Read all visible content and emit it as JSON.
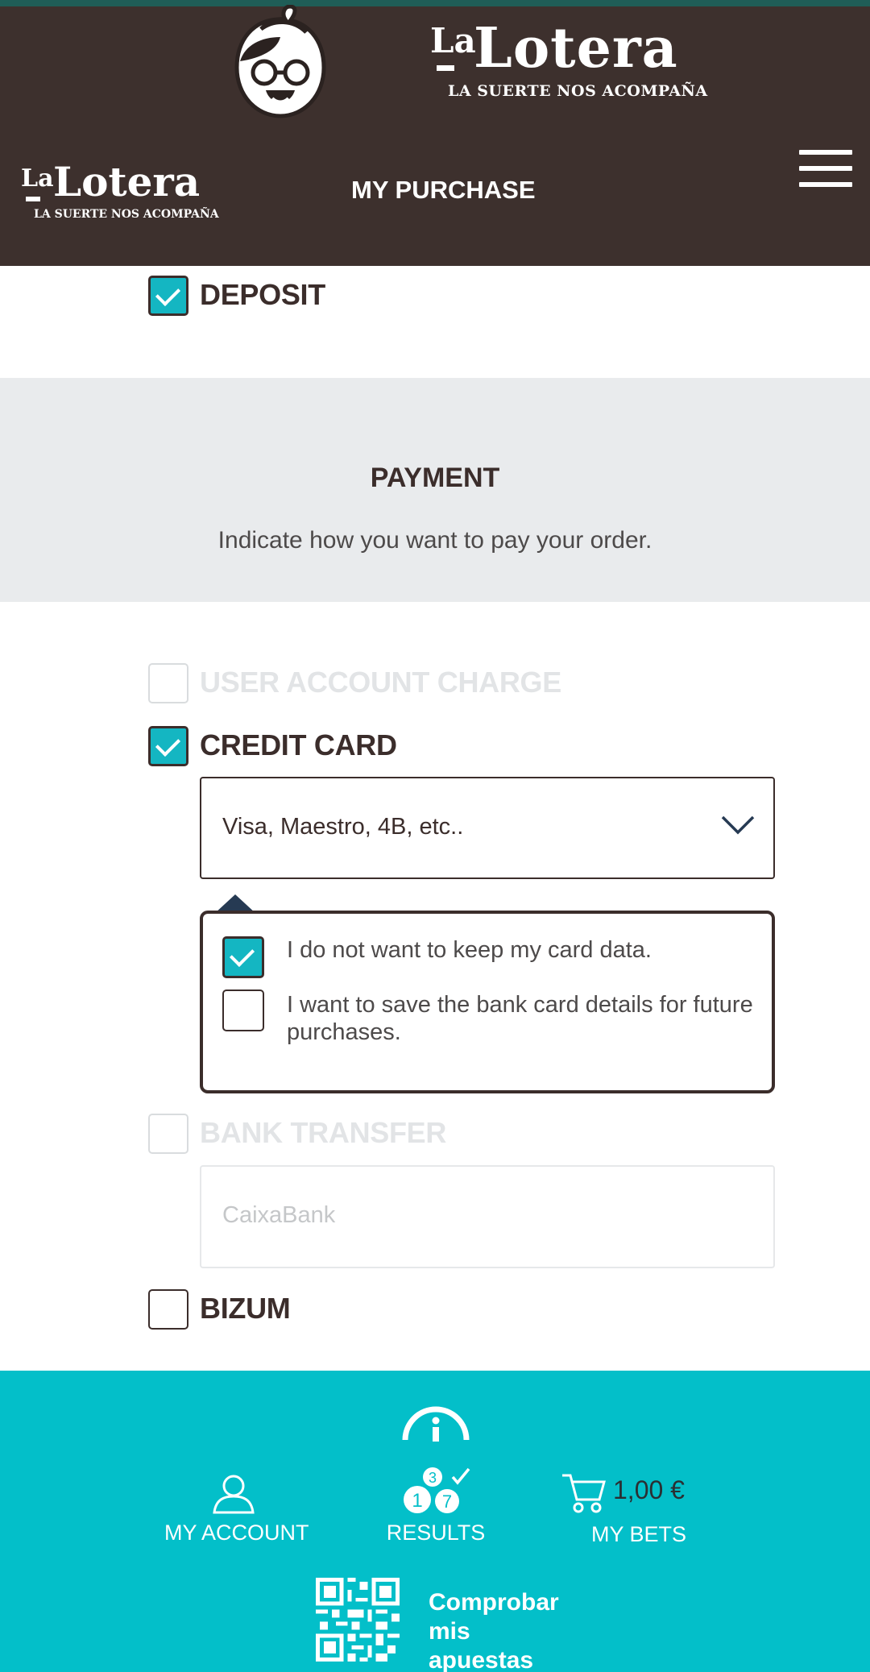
{
  "header": {
    "logo": {
      "la": "La",
      "name": "Lotera",
      "tagline": "LA SUERTE NOS ACOMPAÑA"
    },
    "title": "MY PURCHASE"
  },
  "deposit": {
    "label": "DEPOSIT",
    "checked": true
  },
  "payment": {
    "title": "PAYMENT",
    "subtitle": "Indicate how you want to pay your order."
  },
  "options": {
    "user_account": {
      "label": "USER ACCOUNT CHARGE",
      "checked": false,
      "disabled": true
    },
    "credit_card": {
      "label": "CREDIT CARD",
      "checked": true,
      "select_value": "Visa, Maestro, 4B, etc..",
      "keep_data_options": [
        {
          "label": "I do not want to keep my card data.",
          "checked": true
        },
        {
          "label": "I want to save the bank card details for future purchases.",
          "checked": false
        }
      ]
    },
    "bank_transfer": {
      "label": "BANK TRANSFER",
      "checked": false,
      "disabled": true,
      "select_value": "CaixaBank"
    },
    "bizum": {
      "label": "BIZUM",
      "checked": false
    }
  },
  "footer": {
    "my_account": "MY ACCOUNT",
    "results": "RESULTS",
    "results_numbers": [
      "1",
      "3",
      "7"
    ],
    "my_bets": "MY BETS",
    "cart_total": "1,00 €",
    "check_bets": "Comprobar mis apuestas"
  },
  "colors": {
    "header_bg": "#3d302d",
    "accent": "#14b6c2",
    "footer_bg": "#03bfc9",
    "banner_bg": "#e9ebed"
  }
}
